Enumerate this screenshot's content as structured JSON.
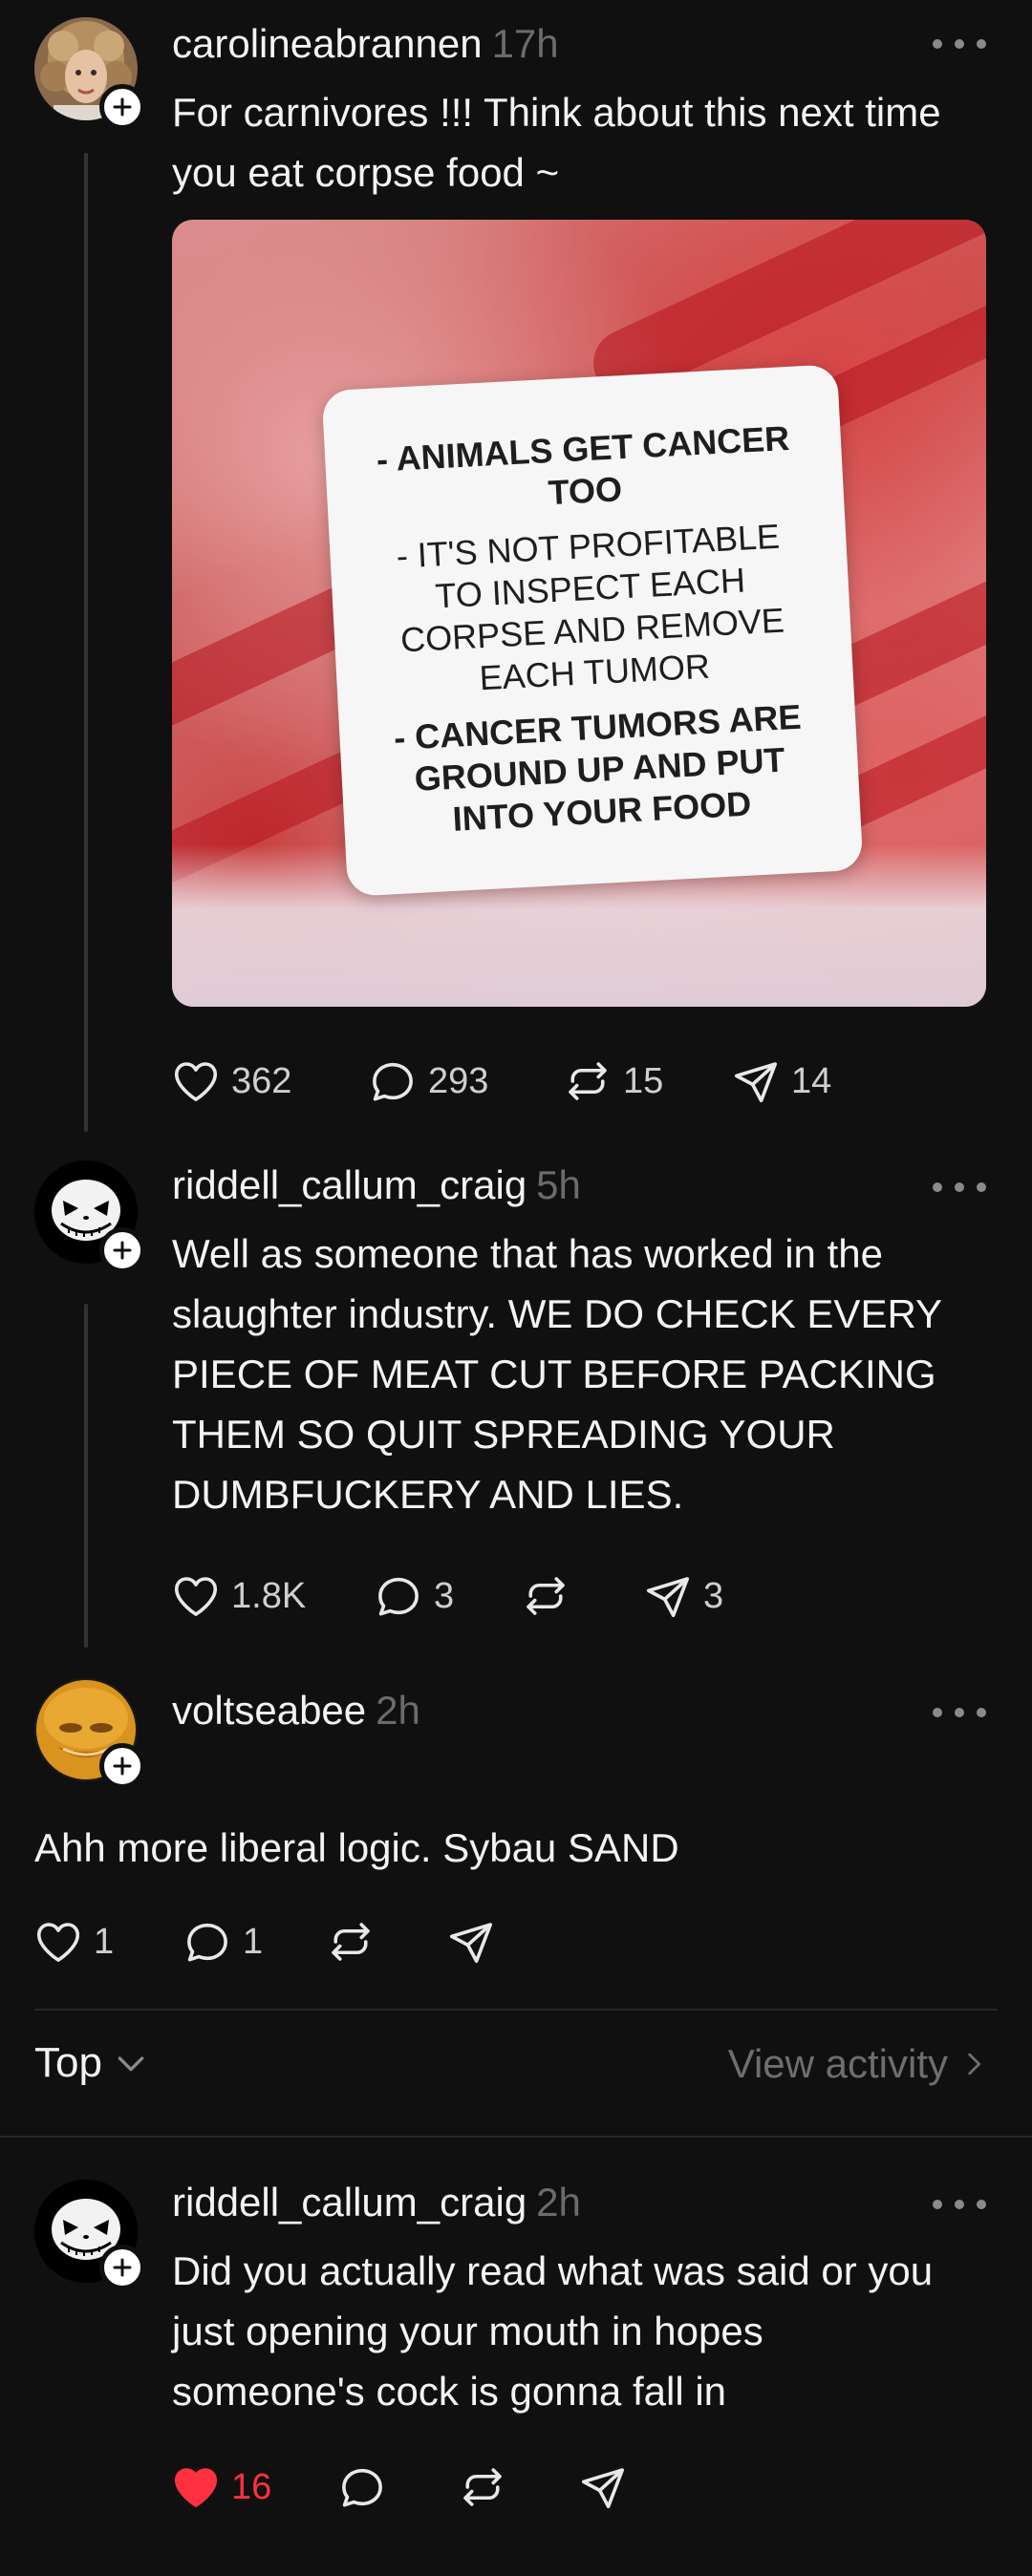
{
  "posts": [
    {
      "username": "carolineabrannen",
      "time": "17h",
      "text_lines": [
        "For carnivores !!! Think about this next time",
        "you eat corpse food ~"
      ],
      "image_label": [
        {
          "text": "- ANIMALS GET CANCER",
          "bold": true
        },
        {
          "text": "TOO",
          "bold": true
        },
        {
          "text": "- IT'S NOT PROFITABLE",
          "bold": false
        },
        {
          "text": "TO INSPECT EACH",
          "bold": false
        },
        {
          "text": "CORPSE AND REMOVE",
          "bold": false
        },
        {
          "text": "EACH TUMOR",
          "bold": false
        },
        {
          "text": "- CANCER TUMORS ARE",
          "bold": true
        },
        {
          "text": "GROUND UP AND PUT",
          "bold": true
        },
        {
          "text": "INTO YOUR FOOD",
          "bold": true
        }
      ],
      "likes": "362",
      "replies": "293",
      "reposts": "15",
      "shares": "14"
    },
    {
      "username": "riddell_callum_craig",
      "time": "5h",
      "text_lines": [
        "Well as someone that has worked in the",
        "slaughter industry. WE DO CHECK EVERY",
        "PIECE OF MEAT CUT BEFORE PACKING",
        "THEM SO QUIT SPREADING YOUR",
        "DUMBFUCKERY AND LIES."
      ],
      "likes": "1.8K",
      "replies": "3",
      "reposts": "",
      "shares": "3"
    },
    {
      "username": "voltseabee",
      "time": "2h",
      "text": "Ahh more liberal logic. Sybau  SAND",
      "likes": "1",
      "replies": "1",
      "reposts": "",
      "shares": ""
    },
    {
      "username": "riddell_callum_craig",
      "time": "2h",
      "text_lines": [
        "Did you actually read what was said or you",
        "just opening your mouth in hopes",
        "someone's cock is gonna fall in"
      ],
      "likes": "16",
      "liked": true,
      "replies": "",
      "reposts": "",
      "shares": ""
    }
  ],
  "sort": {
    "label": "Top",
    "view_activity": "View activity"
  },
  "colors": {
    "background": "#101010",
    "liked": "#ff3040",
    "muted": "#6b6b6b"
  }
}
